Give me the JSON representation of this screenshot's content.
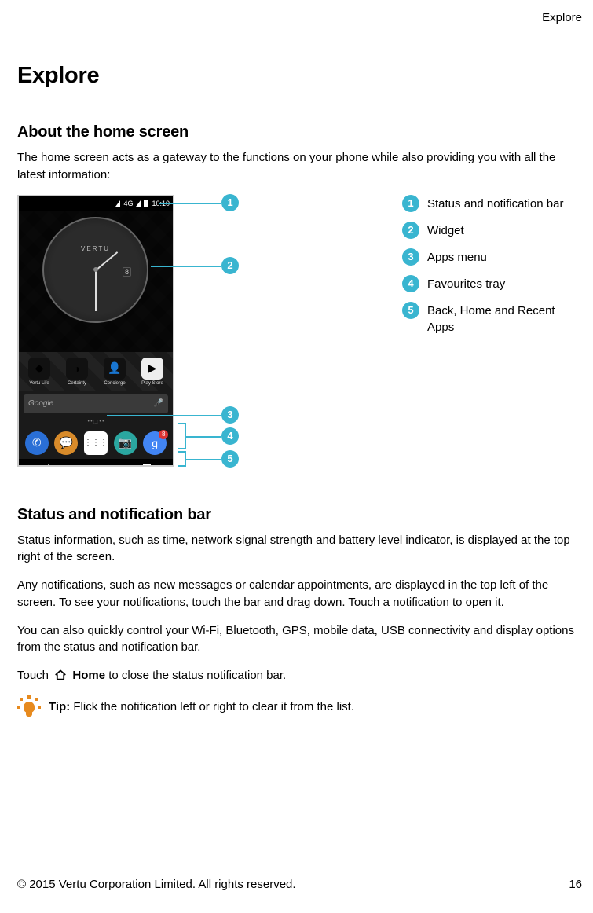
{
  "header_label": "Explore",
  "title": "Explore",
  "section_about": {
    "heading": "About the home screen",
    "intro": "The home screen acts as a gateway to the functions on your phone while also providing you with all the latest information:"
  },
  "phone": {
    "status_4g": "4G",
    "status_time": "10:10",
    "watch_brand": "VERTU",
    "watch_date": "8",
    "apps": [
      "Vertu Life",
      "Certainty",
      "Concierge",
      "Play Store"
    ],
    "search_brand": "Google",
    "page_dots": "• • ⬚ • •",
    "fav_grid": "⋮⋮⋮",
    "nav_back": "〈",
    "nav_home": "⌂",
    "g_letter": "g"
  },
  "callouts": {
    "n1": "1",
    "n2": "2",
    "n3": "3",
    "n4": "4",
    "n5": "5"
  },
  "legend": [
    {
      "n": "1",
      "text": "Status and notification bar"
    },
    {
      "n": "2",
      "text": "Widget"
    },
    {
      "n": "3",
      "text": "Apps menu"
    },
    {
      "n": "4",
      "text": "Favourites tray"
    },
    {
      "n": "5",
      "text": "Back, Home and Recent Apps"
    }
  ],
  "section_status": {
    "heading": "Status and notification bar",
    "p1": "Status information, such as time, network signal strength and battery level indicator, is displayed at the top right of the screen.",
    "p2": "Any notifications, such as new messages or calendar appointments, are displayed in the top left of the screen. To see your notifications, touch the bar and drag down. Touch a notification to open it.",
    "p3": "You can also quickly control your Wi-Fi, Bluetooth, GPS, mobile data, USB connectivity and display options from the status and notification bar.",
    "touch_pre": "Touch ",
    "home_label": "Home",
    "touch_post": " to close the status notification bar."
  },
  "tip": {
    "label": "Tip:",
    "text": " Flick the notification left or right to clear it from the list."
  },
  "footer": {
    "copyright": "© 2015 Vertu Corporation Limited. All rights reserved.",
    "page": "16"
  }
}
